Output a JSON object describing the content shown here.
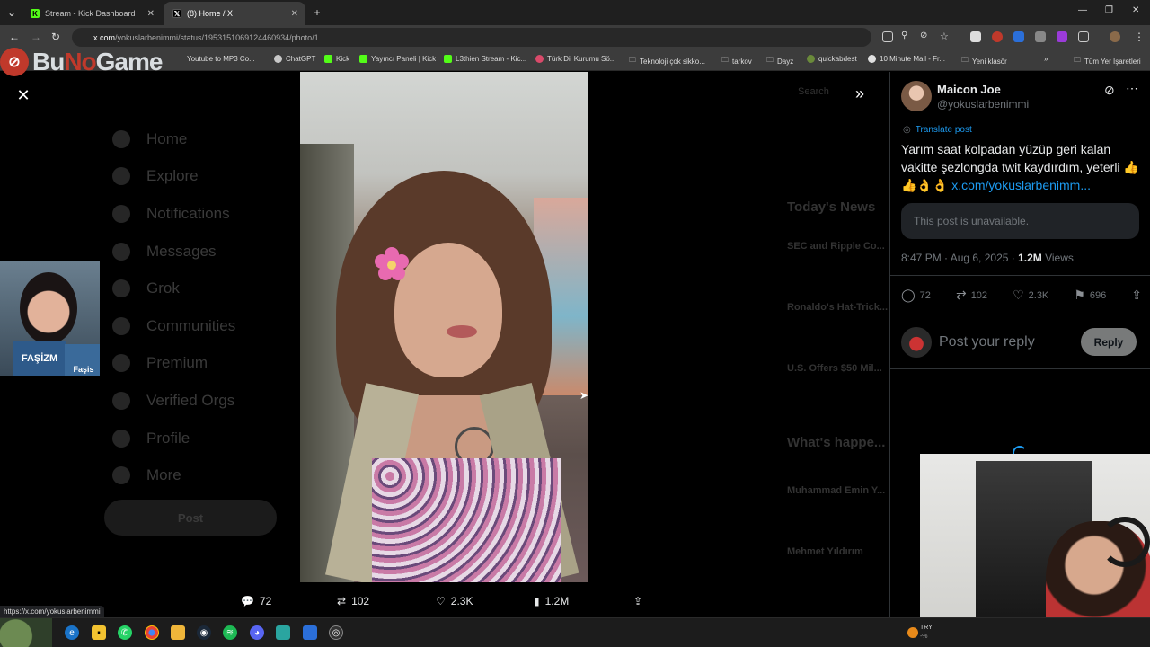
{
  "tabs": [
    {
      "title": "Stream - Kick Dashboard",
      "favicon_color": "#53fc18",
      "favicon_glyph": "K"
    },
    {
      "title": "(8) Home / X",
      "favicon_color": "#ffffff",
      "favicon_glyph": "𝕏"
    }
  ],
  "address": {
    "host": "x.com",
    "path": "/yokuslarbenimmi/status/1953151069124460934/photo/1"
  },
  "bookmarks": [
    {
      "label": "Youtube to MP3 Co...",
      "color": "#e03b2b"
    },
    {
      "label": "ChatGPT",
      "color": "#c8c8c8"
    },
    {
      "label": "Kick",
      "color": "#53fc18"
    },
    {
      "label": "Yayıncı Paneli | Kick",
      "color": "#53fc18"
    },
    {
      "label": "L3thien Stream - Kic...",
      "color": "#53fc18"
    },
    {
      "label": "Türk Dil Kurumu Sö...",
      "color": "#d94a6a"
    },
    {
      "label": "Teknoloji çok sikko...",
      "color": "folder"
    },
    {
      "label": "tarkov",
      "color": "folder"
    },
    {
      "label": "Dayz",
      "color": "folder"
    },
    {
      "label": "quickabdest",
      "color": "#6a8a3a"
    },
    {
      "label": "10 Minute Mail - Fr...",
      "color": "#e0e0e0"
    },
    {
      "label": "Yeni klasör",
      "color": "folder"
    },
    {
      "label": "Tüm Yer İşaretleri",
      "color": "folder"
    }
  ],
  "overlay_logo": {
    "prefix": "Bu",
    "accent": "No",
    "suffix": "Game"
  },
  "background_nav": [
    "Home",
    "Explore",
    "Notifications",
    "Messages",
    "Grok",
    "Communities",
    "Premium",
    "Verified Orgs",
    "Profile",
    "More"
  ],
  "background_post_button": "Post",
  "background_right": {
    "search": "Search",
    "todays_news": "Today's News",
    "news": [
      "SEC and Ripple Co...",
      "Ronaldo's Hat-Trick...",
      "U.S. Offers $50 Mil..."
    ],
    "whats_happening": "What's happe...",
    "trends": [
      "Muhammad Emin Y...",
      "Mehmet Yıldırım"
    ]
  },
  "media_actions": {
    "replies": "72",
    "reposts": "102",
    "likes": "2.3K",
    "views": "1.2M"
  },
  "status_bar_url": "https://x.com/yokuslarbenimmi",
  "post": {
    "display_name": "Maicon Joe",
    "handle": "@yokuslarbenimmi",
    "translate": "Translate post",
    "text": "Yarım saat kolpadan yüzüp geri kalan vakitte şezlongda twit kaydırdım, yeterli 👍👍👌👌",
    "link": "x.com/yokuslarbenimm...",
    "unavailable": "This post is unavailable.",
    "time": "8:47 PM · Aug 6, 2025 · ",
    "views_count": "1.2M",
    "views_label": " Views",
    "stats": {
      "replies": "72",
      "reposts": "102",
      "likes": "2.3K",
      "bookmarks": "696"
    }
  },
  "reply": {
    "placeholder": "Post your reply",
    "button": "Reply"
  },
  "webcam_left": {
    "book_title": "FAŞİZM",
    "book_title_2": "Faşis"
  },
  "tray": {
    "line1": "TRY",
    "line2": "-%"
  },
  "colors": {
    "accent": "#1d9bf0",
    "background": "#000000",
    "text": "#e7e9ea",
    "muted": "#71767b"
  }
}
